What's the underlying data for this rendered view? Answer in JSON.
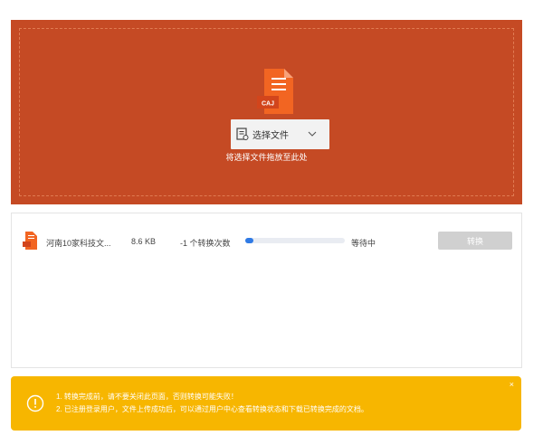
{
  "upload": {
    "file_type_tag": "CAJ",
    "select_label": "选择文件",
    "drop_hint": "将选择文件拖放至此处",
    "colors": {
      "drop_bg": "#c54a24",
      "icon": "#f26522"
    }
  },
  "file_list": {
    "rows": [
      {
        "name": "河南10家科技文...",
        "size": "8.6 KB",
        "count_text": "-1 个转换次数",
        "progress": 0.08,
        "status": "等待中",
        "action_label": "转换"
      }
    ]
  },
  "notice": {
    "lines": [
      "1. 转换完成前，请不要关闭此页面，否则转换可能失败！",
      "2. 已注册登录用户，文件上传成功后，可以通过用户中心查看转换状态和下载已转换完成的文档。"
    ],
    "close_symbol": "×",
    "colors": {
      "bg": "#f7b600"
    }
  }
}
